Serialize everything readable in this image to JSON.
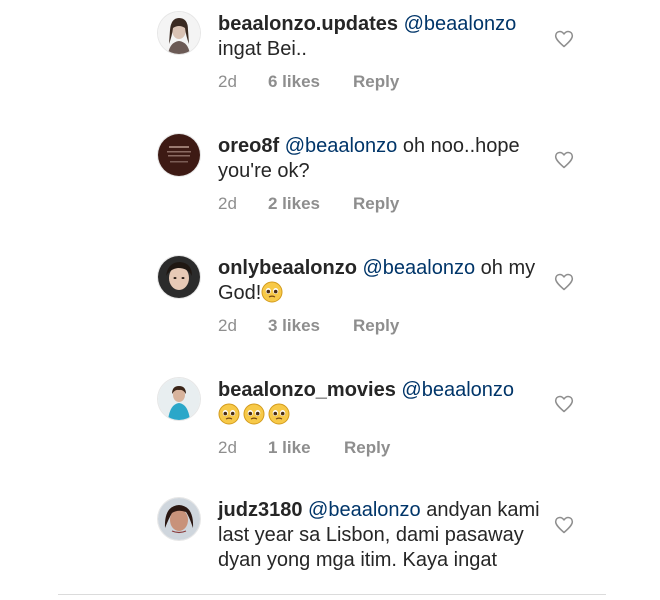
{
  "comments": [
    {
      "username": "beaalonzo.updates",
      "mention": "@beaalonzo",
      "text": "ingat Bei..",
      "time": "2d",
      "likes": "6 likes",
      "reply": "Reply",
      "emojis": []
    },
    {
      "username": "oreo8f",
      "mention": "@beaalonzo",
      "text": "oh noo..hope you're ok?",
      "time": "2d",
      "likes": "2 likes",
      "reply": "Reply",
      "emojis": []
    },
    {
      "username": "onlybeaalonzo",
      "mention": "@beaalonzo",
      "text": "oh my God!",
      "time": "2d",
      "likes": "3 likes",
      "reply": "Reply",
      "emojis": [
        "pleading-face"
      ]
    },
    {
      "username": "beaalonzo_movies",
      "mention": "@beaalonzo",
      "text": "",
      "time": "2d",
      "likes": "1 like",
      "reply": "Reply",
      "emojis": [
        "pleading-face",
        "pleading-face",
        "pleading-face"
      ]
    },
    {
      "username": "judz3180",
      "mention": "@beaalonzo",
      "text": "andyan kami last year sa Lisbon, dami pasaway dyan yong mga itim. Kaya ingat",
      "time": "",
      "likes": "",
      "reply": "",
      "emojis": []
    }
  ],
  "icons": {
    "like": "heart-outline-icon",
    "emoji": "pleading-face"
  },
  "colors": {
    "username": "#262626",
    "mention": "#003569",
    "meta": "#8e8e8e",
    "heart_stroke": "#8e8e8e"
  }
}
